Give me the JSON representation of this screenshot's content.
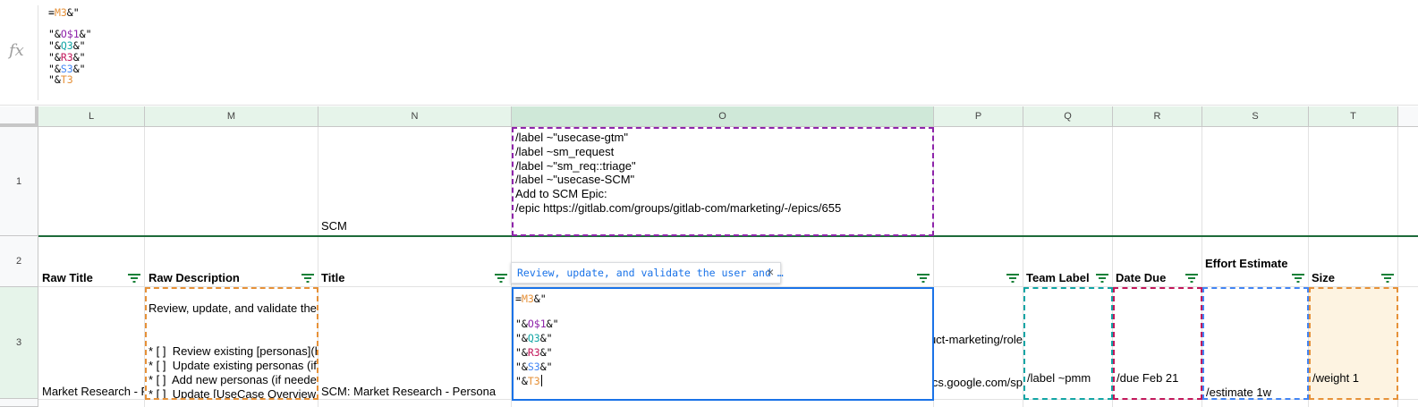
{
  "formula_bar": {
    "fx_label": "fx",
    "lines": [
      [
        {
          "t": "="
        },
        {
          "t": "M3",
          "c": "orange"
        },
        {
          "t": "&\""
        }
      ],
      [],
      [
        {
          "t": "\"&"
        },
        {
          "t": "O$1",
          "c": "purple"
        },
        {
          "t": "&\""
        }
      ],
      [
        {
          "t": "\"&"
        },
        {
          "t": "Q3",
          "c": "teal"
        },
        {
          "t": "&\""
        }
      ],
      [
        {
          "t": "\"&"
        },
        {
          "t": "R3",
          "c": "red"
        },
        {
          "t": "&\""
        }
      ],
      [
        {
          "t": "\"&"
        },
        {
          "t": "S3",
          "c": "blue"
        },
        {
          "t": "&\""
        }
      ],
      [
        {
          "t": "\"&"
        },
        {
          "t": "T3",
          "c": "orange"
        }
      ]
    ]
  },
  "columns": [
    "L",
    "M",
    "N",
    "O",
    "P",
    "Q",
    "R",
    "S",
    "T"
  ],
  "rows": [
    "1",
    "2",
    "3"
  ],
  "row1": {
    "n1": "SCM",
    "o1": "/label ~\"usecase-gtm\"\n/label ~sm_request\n/label ~\"sm_req::triage\"\n/label ~\"usecase-SCM\"\nAdd to SCM Epic:\n/epic https://gitlab.com/groups/gitlab-com/marketing/-/epics/655"
  },
  "headers": {
    "raw_title": "Raw Title",
    "raw_description": "Raw Description",
    "title": "Title",
    "team_label": "Team Label",
    "date_due": "Date Due",
    "effort_estimate": "Effort Estimate",
    "size": "Size"
  },
  "tooltip": {
    "text": "Review, update, and validate the user and …",
    "close": "×"
  },
  "row3": {
    "l3": "Market Research - P",
    "m3_top": "Review, update, and validate the",
    "m3_list": [
      "* [ ]  Review existing [personas](h",
      "* [ ]  Update existing personas (if",
      "* [ ]  Add new personas (if neede",
      "* [ ]  Update [UseCase Overview"
    ],
    "n3": "SCM: Market Research - Persona",
    "p3_a": "uct-marketing/role",
    "p3_b": "ocs.google.com/sp",
    "q3": "/label ~pmm",
    "r3": "/due Feb 21",
    "s3": "/estimate 1w",
    "t3": "/weight 1"
  },
  "colors": {
    "orange": "#e69138",
    "purple": "#8e24aa",
    "teal": "#12a5a5",
    "red": "#c2185b",
    "blue": "#4285f4",
    "select_blue": "#1a73e8",
    "filter_green": "#188038"
  }
}
